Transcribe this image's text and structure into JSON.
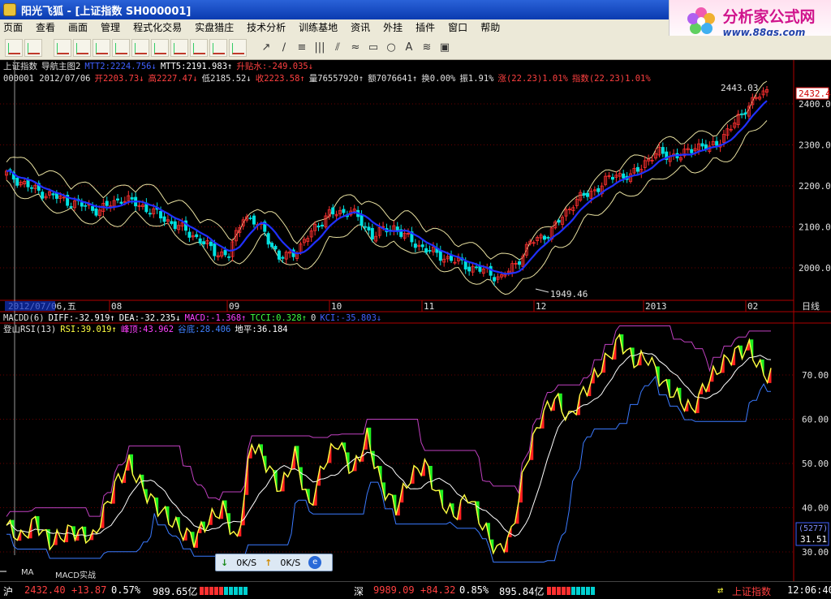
{
  "window": {
    "title": "阳光飞狐 - [上证指数 SH000001]"
  },
  "logo": {
    "title": "分析家公式网",
    "url": "www.88gs.com"
  },
  "menu": [
    "页面",
    "查看",
    "画面",
    "管理",
    "程式化交易",
    "实盘猎庄",
    "技术分析",
    "训练基地",
    "资讯",
    "外挂",
    "插件",
    "窗口",
    "帮助"
  ],
  "top_info": {
    "line1": [
      {
        "text": "上证指数",
        "color": "#e0e0e0"
      },
      {
        "text": "导航主图2",
        "color": "#e0e0e0"
      },
      {
        "text": "MTT2:2224.756↓",
        "color": "#4060ff"
      },
      {
        "text": "MTT5:2191.983↑",
        "color": "#ffffff"
      },
      {
        "text": "升贴水:-249.035↓",
        "color": "#ff4040"
      }
    ],
    "line2": [
      {
        "text": "000001 2012/07/06",
        "color": "#e0e0e0"
      },
      {
        "text": "开2203.73↓",
        "color": "#ff4040"
      },
      {
        "text": "高2227.47↓",
        "color": "#ff4040"
      },
      {
        "text": "低2185.52↓",
        "color": "#e0e0e0"
      },
      {
        "text": "收2223.58↑",
        "color": "#ff4040"
      },
      {
        "text": "量76557920↑",
        "color": "#e0e0e0"
      },
      {
        "text": "额7076641↑",
        "color": "#e0e0e0"
      },
      {
        "text": "换0.00%",
        "color": "#e0e0e0"
      },
      {
        "text": "振1.91%",
        "color": "#e0e0e0"
      },
      {
        "text": "涨(22.23)1.01%",
        "color": "#ff4040"
      },
      {
        "text": "指数(22.23)1.01%",
        "color": "#ff4040"
      }
    ]
  },
  "price_chart": {
    "y_ticks": [
      "2400.00",
      "2300.00",
      "2200.00",
      "2100.00",
      "2000.00"
    ],
    "high_label": "2443.03",
    "low_label": "1949.46",
    "last_price": "2432.4",
    "x_labels": [
      "2012/07/06,五",
      "08",
      "09",
      "10",
      "11",
      "12",
      "2013",
      "02"
    ],
    "period": "日线"
  },
  "sub_info": {
    "line1": [
      {
        "text": "MACDD(6)",
        "color": "#e0e0e0"
      },
      {
        "text": "DIFF:-32.919↑",
        "color": "#ffffff"
      },
      {
        "text": "DEA:-32.235↓",
        "color": "#ffffff"
      },
      {
        "text": "MACD:-1.368↑",
        "color": "#ff40ff"
      },
      {
        "text": "TCCI:0.328↑",
        "color": "#40ff40"
      },
      {
        "text": "0",
        "color": "#e0e0e0"
      },
      {
        "text": "KCI:-35.803↓",
        "color": "#4060ff"
      }
    ],
    "line2": [
      {
        "text": "登山RSI(13)",
        "color": "#e0e0e0"
      },
      {
        "text": "RSI:39.019↑",
        "color": "#ffff40"
      },
      {
        "text": "峰顶:43.962",
        "color": "#ff40ff"
      },
      {
        "text": "谷底:28.406",
        "color": "#4080ff"
      },
      {
        "text": "地平:36.184",
        "color": "#ffffff"
      }
    ]
  },
  "indicator_chart": {
    "y_ticks": [
      "70.00",
      "60.00",
      "50.00",
      "40.00",
      "30.00"
    ],
    "box_top": "(5277)",
    "box_value": "31.51"
  },
  "tabs": [
    "MA",
    "MACD实战"
  ],
  "floater": {
    "down_label": "0K/S",
    "up_label": "0K/S"
  },
  "status": {
    "sh": {
      "label": "沪",
      "price": "2432.40",
      "change": "+13.87",
      "pct": "0.57%",
      "amount": "989.65亿"
    },
    "sz": {
      "label": "深",
      "price": "9989.09",
      "change": "+84.32",
      "pct": "0.85%",
      "amount": "895.84亿"
    },
    "name": "上证指数",
    "time": "12:06:40"
  },
  "colors": {
    "up": "#ff3030",
    "down": "#00e0e0",
    "ma": "#2030ff",
    "yellow": "#ffff40",
    "magenta": "#c040c0",
    "blue": "#3a7aff"
  }
}
